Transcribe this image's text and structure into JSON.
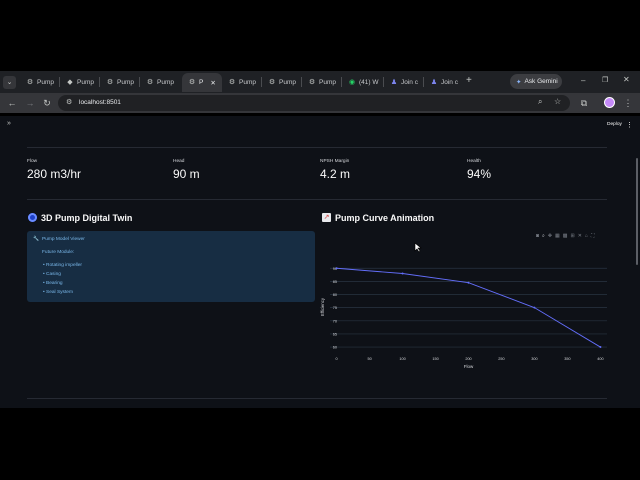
{
  "browser": {
    "tabs": [
      {
        "label": "Pump",
        "icon": "gear-icon"
      },
      {
        "label": "Pump",
        "icon": "streamlit-icon"
      },
      {
        "label": "Pump",
        "icon": "gear-icon"
      },
      {
        "label": "Pump",
        "icon": "gear-icon"
      },
      {
        "label": "P",
        "icon": "gear-icon",
        "active": true
      },
      {
        "label": "Pump",
        "icon": "gear-icon"
      },
      {
        "label": "Pump",
        "icon": "gear-icon"
      },
      {
        "label": "Pump",
        "icon": "gear-icon"
      },
      {
        "label": "(41) W",
        "icon": "whatsapp-icon"
      },
      {
        "label": "Join c",
        "icon": "teams-icon"
      },
      {
        "label": "Join c",
        "icon": "teams-icon"
      }
    ],
    "ask_gemini": "Ask Gemini",
    "url": "localhost:8501"
  },
  "app": {
    "deploy_label": "Deploy",
    "metrics": [
      {
        "label": "Flow",
        "value": "280 m3/hr"
      },
      {
        "label": "Head",
        "value": "90 m"
      },
      {
        "label": "NPSH Margin",
        "value": "4.2 m"
      },
      {
        "label": "Health",
        "value": "94%"
      }
    ],
    "twin": {
      "title": "3D Pump Digital Twin",
      "icon": "target-icon",
      "viewer_label": "Pump Model Viewer",
      "future_label": "Future Module:",
      "items": [
        "Rotating impeller",
        "Casing",
        "Bearing",
        "Seal System"
      ]
    },
    "curve": {
      "title": "Pump Curve Animation",
      "icon": "chart-icon"
    }
  },
  "chart_data": {
    "type": "line",
    "x": [
      0,
      100,
      200,
      300,
      400
    ],
    "series": [
      {
        "values": [
          90,
          88,
          84.5,
          75,
          60
        ]
      }
    ],
    "xlabel": "Flow",
    "ylabel": "Efficiency",
    "xticks": [
      "0",
      "50",
      "100",
      "150",
      "200",
      "250",
      "300",
      "350",
      "400"
    ],
    "yticks": [
      "60",
      "65",
      "70",
      "75",
      "80",
      "85",
      "90"
    ],
    "xlim": [
      -10,
      410
    ],
    "ylim": [
      58.5,
      92
    ],
    "grid": true,
    "line_color": "#636efa"
  }
}
